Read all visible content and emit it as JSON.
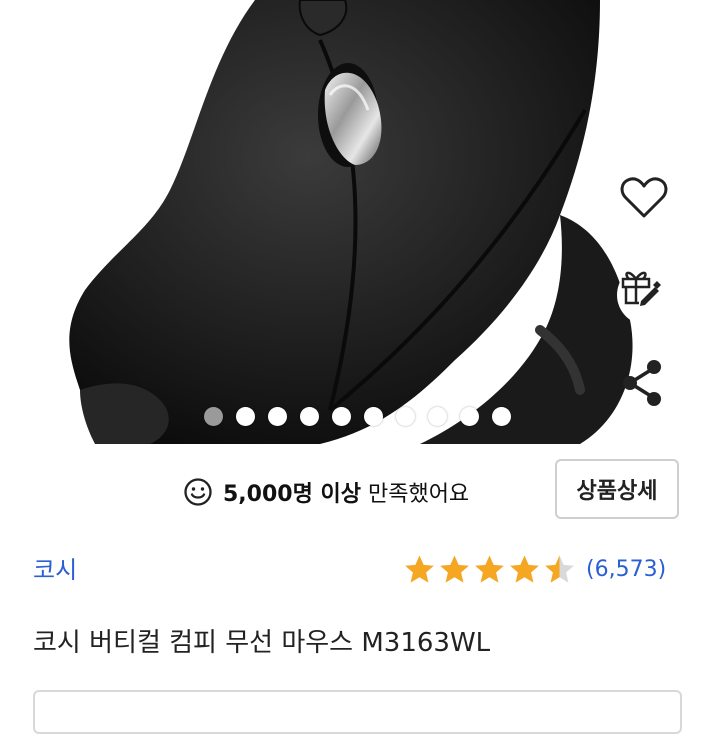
{
  "carousel": {
    "total": 10,
    "active_index": 0
  },
  "actions": {
    "wishlist": "heart-icon",
    "gift": "gift-icon",
    "share": "share-icon"
  },
  "satisfaction": {
    "count_text": "5,000명 이상",
    "suffix_text": "만족했어요"
  },
  "detail_button": {
    "label": "상품상세"
  },
  "brand": {
    "name": "코시"
  },
  "rating": {
    "value": 4.5,
    "max": 5,
    "count_text": "(6,573)"
  },
  "product": {
    "title": "코시 버티컬 컴피 무선 마우스 M3163WL"
  },
  "colors": {
    "accent_blue": "#2b5fd4",
    "star_gold": "#f5a623",
    "star_empty": "#d9d9d9"
  }
}
